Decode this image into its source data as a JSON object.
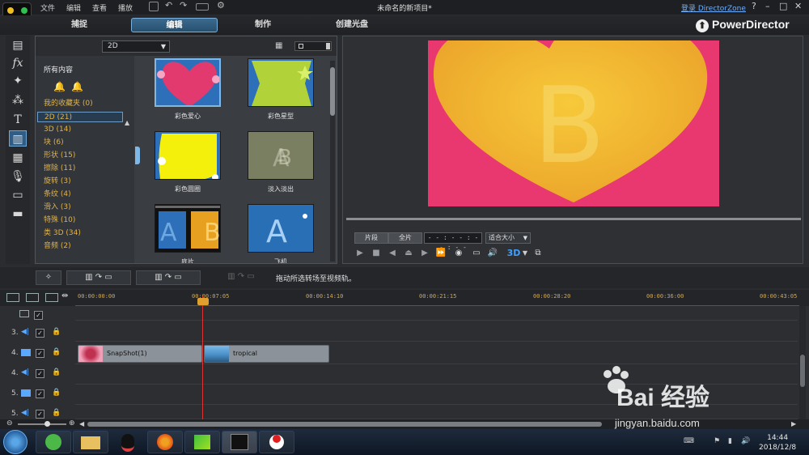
{
  "menu": {
    "file": "文件",
    "edit": "编辑",
    "view": "查看",
    "play": "播放"
  },
  "window": {
    "title": "未命名的新项目*",
    "login": "登录 DirectorZone",
    "help": "?",
    "minimize": "–",
    "maximize": "□",
    "close": "✕"
  },
  "modes": {
    "capture": "捕捉",
    "edit": "编辑",
    "produce": "制作",
    "disc": "创建光盘"
  },
  "brand": "PowerDirector",
  "library": {
    "type_select": "2D",
    "all_content": "所有内容",
    "categories": [
      {
        "label": "我的收藏夹 (0)"
      },
      {
        "label": "2D (21)"
      },
      {
        "label": "3D (14)"
      },
      {
        "label": "块 (6)"
      },
      {
        "label": "形状 (15)"
      },
      {
        "label": "擦除 (11)"
      },
      {
        "label": "旋转 (3)"
      },
      {
        "label": "条纹 (4)"
      },
      {
        "label": "滑入 (3)"
      },
      {
        "label": "特殊 (10)"
      },
      {
        "label": "类 3D (34)"
      },
      {
        "label": "音频 (2)"
      }
    ],
    "thumbnails": [
      {
        "label": "彩色爱心"
      },
      {
        "label": "彩色星型"
      },
      {
        "label": "彩色圆圈"
      },
      {
        "label": "淡入淡出"
      },
      {
        "label": "底片"
      },
      {
        "label": "飞机"
      }
    ]
  },
  "preview": {
    "letter": "B",
    "clip_button": "片段",
    "full_button": "全片",
    "timecode": "- - : - - : - - : - -",
    "fit_select": "适合大小",
    "mode_3d": "3D"
  },
  "edit_toolbar": {
    "hint": "拖动所选转场至视频轨。"
  },
  "timeline": {
    "ruler": [
      "00:00:00:00",
      "00:00:07:05",
      "00:00:14:10",
      "00:00:21:15",
      "00:00:28:20",
      "00:00:36:00",
      "00:00:43:05"
    ],
    "tracks": [
      {
        "num": "3.",
        "check": "✓"
      },
      {
        "num": "4.",
        "check": "✓"
      },
      {
        "num": "4.",
        "check": "✓"
      },
      {
        "num": "5.",
        "check": "✓"
      },
      {
        "num": "5.",
        "check": "✓"
      }
    ],
    "clips": [
      {
        "label": "SnapShot(1)"
      },
      {
        "label": "tropical"
      }
    ]
  },
  "taskbar": {
    "time": "14:44",
    "date": "2018/12/8"
  },
  "watermark": {
    "text": "Bai 经验",
    "site": "jingyan.baidu.com"
  },
  "colors": {
    "accent": "#3c6b8f",
    "category_text": "#e0b24a",
    "playhead": "#dd3333",
    "ruler_text": "#d4a84c"
  }
}
